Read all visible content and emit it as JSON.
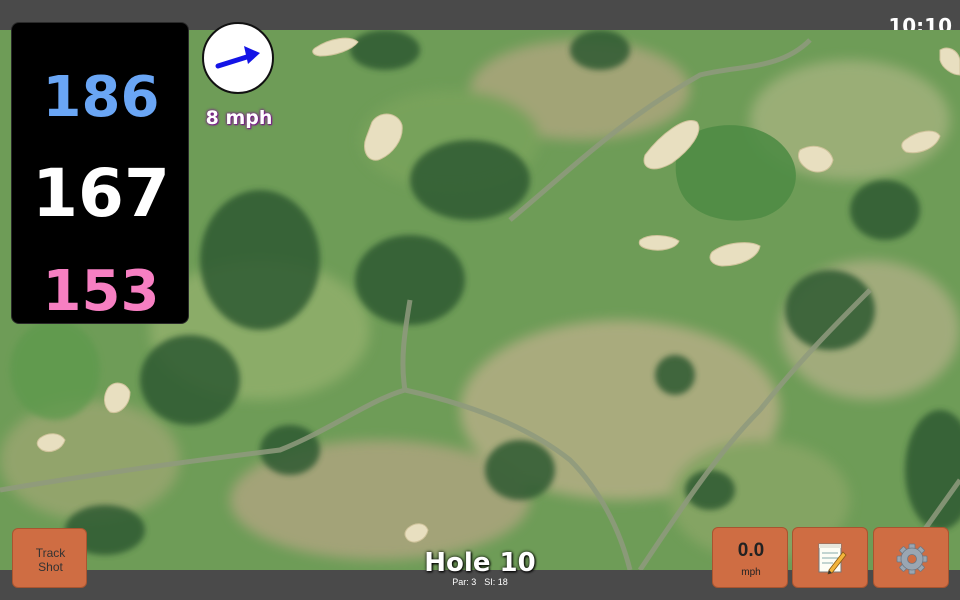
{
  "status_bar": {
    "time": "10:10"
  },
  "distances": {
    "back": "186",
    "center": "167",
    "front": "153"
  },
  "wind": {
    "speed_label": "8 mph",
    "direction": "east-north-east",
    "arrow_color": "#1414e6"
  },
  "track_shot": {
    "line1": "Track",
    "line2": "Shot"
  },
  "hole": {
    "title": "Hole 10",
    "par": "Par: 3",
    "si": "SI: 18"
  },
  "speed_button": {
    "value": "0.0",
    "unit": "mph"
  },
  "icons": {
    "notes": "notepad-icon",
    "settings": "gear-icon"
  },
  "colors": {
    "back_distance": "#6aa6f5",
    "center_distance": "#ffffff",
    "front_distance": "#f77fc2",
    "button": "#cf6d43",
    "bar": "#4a4a4a"
  }
}
